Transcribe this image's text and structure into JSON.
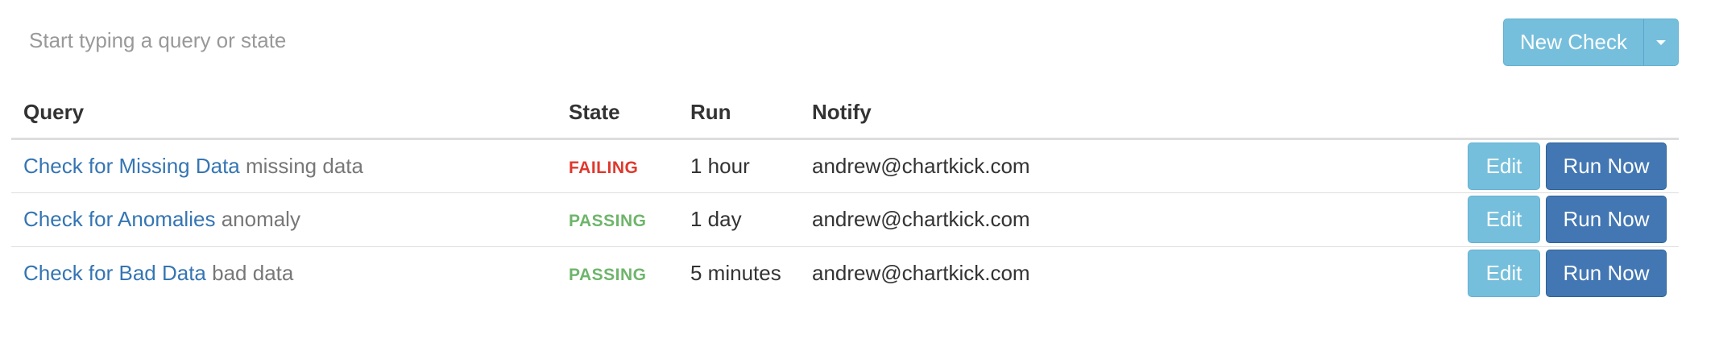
{
  "search": {
    "placeholder": "Start typing a query or state",
    "value": ""
  },
  "toolbar": {
    "new_check_label": "New Check",
    "dropdown_icon": "caret-down-icon"
  },
  "table": {
    "headers": {
      "query": "Query",
      "state": "State",
      "run": "Run",
      "notify": "Notify"
    },
    "rows": [
      {
        "query_name": "Check for Missing Data",
        "query_tag": "missing data",
        "state": "FAILING",
        "state_color": "#e0382c",
        "run": "1 hour",
        "notify": "andrew@chartkick.com",
        "edit_label": "Edit",
        "run_now_label": "Run Now"
      },
      {
        "query_name": "Check for Anomalies",
        "query_tag": "anomaly",
        "state": "PASSING",
        "state_color": "#6eb56b",
        "run": "1 day",
        "notify": "andrew@chartkick.com",
        "edit_label": "Edit",
        "run_now_label": "Run Now"
      },
      {
        "query_name": "Check for Bad Data",
        "query_tag": "bad data",
        "state": "PASSING",
        "state_color": "#6eb56b",
        "run": "5 minutes",
        "notify": "andrew@chartkick.com",
        "edit_label": "Edit",
        "run_now_label": "Run Now"
      }
    ]
  },
  "colors": {
    "link": "#3575b3",
    "info_button": "#75bfdc",
    "primary_button": "#4377b3",
    "failing": "#e0382c",
    "passing": "#6eb56b"
  }
}
